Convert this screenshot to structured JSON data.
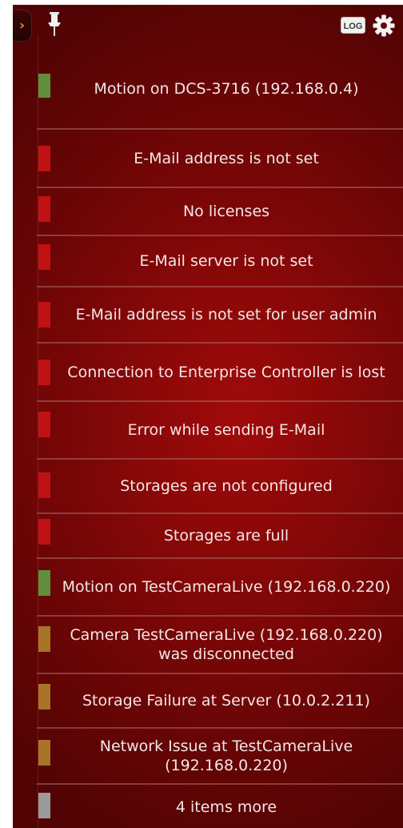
{
  "header": {
    "collapse_glyph": "›",
    "pin_icon": "pin-icon",
    "log_icon": "log-icon",
    "log_label": "LOG",
    "settings_icon": "gear-icon"
  },
  "colors": {
    "green": "#5f8f3b",
    "red": "#c01212",
    "amber": "#a8742a",
    "gray": "#9a9a9a"
  },
  "notifications": [
    {
      "text": "Motion on DCS-3716 (192.168.0.4)",
      "level": "green"
    },
    {
      "text": "E-Mail address is not set",
      "level": "red"
    },
    {
      "text": "No licenses",
      "level": "red"
    },
    {
      "text": "E-Mail server is not set",
      "level": "red"
    },
    {
      "text": "E-Mail address is not set for user admin",
      "level": "red"
    },
    {
      "text": "Connection to Enterprise Controller is lost",
      "level": "red"
    },
    {
      "text": "Error while sending E-Mail",
      "level": "red"
    },
    {
      "text": "Storages are not configured",
      "level": "red"
    },
    {
      "text": "Storages are full",
      "level": "red"
    },
    {
      "text": "Motion on TestCameraLive (192.168.0.220)",
      "level": "green"
    },
    {
      "text": "Camera TestCameraLive (192.168.0.220) was disconnected",
      "level": "amber"
    },
    {
      "text": "Storage Failure at Server (10.0.2.211)",
      "level": "amber"
    },
    {
      "text": "Network Issue at TestCameraLive (192.168.0.220)",
      "level": "amber"
    },
    {
      "text": "4 items more",
      "level": "gray"
    }
  ]
}
